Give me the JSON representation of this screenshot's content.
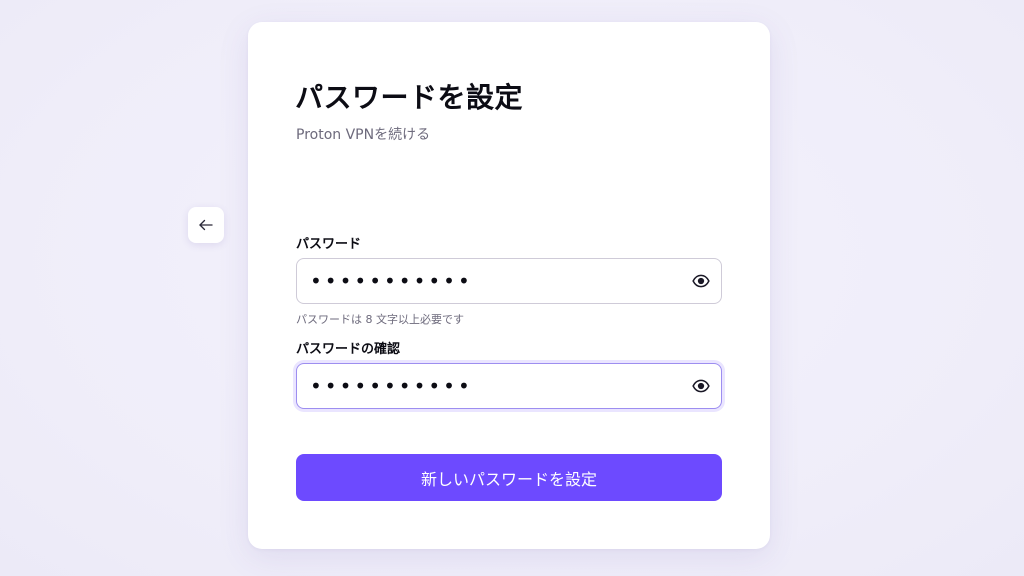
{
  "header": {
    "title": "パスワードを設定",
    "subtitle": "Proton VPNを続ける"
  },
  "navigation": {
    "back_icon": "arrow-left-icon"
  },
  "form": {
    "password": {
      "label": "パスワード",
      "value": "•••••••••••",
      "hint": "パスワードは 8 文字以上必要です",
      "toggle_icon": "eye-icon"
    },
    "confirm": {
      "label": "パスワードの確認",
      "value": "•••••••••••",
      "toggle_icon": "eye-icon"
    },
    "submit_label": "新しいパスワードを設定"
  },
  "colors": {
    "accent": "#6d4aff",
    "focus_border": "#9d8ef0",
    "background": "#f1effb"
  }
}
